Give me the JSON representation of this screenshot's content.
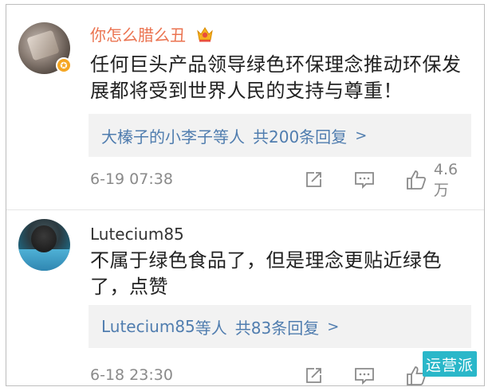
{
  "comments": [
    {
      "username": "你怎么腊么丑",
      "text": "任何巨头产品领导绿色环保理念推动环保发展都将受到世界人民的支持与尊重！",
      "replies_users": "大榛子的小李子",
      "replies_suffix": "等人",
      "replies_count": "共200条回复",
      "timestamp": "6-19 07:38",
      "likes": "4.6万",
      "verified_badge": "v-badge-icon",
      "name_color": "#eb7350"
    },
    {
      "username": "Lutecium85",
      "text": "不属于绿色食品了，但是理念更贴近绿色了，点赞",
      "replies_users": "Lutecium85",
      "replies_suffix": "等人",
      "replies_count": "共83条回复",
      "timestamp": "6-18 23:30",
      "likes": "",
      "name_color": "#333333"
    }
  ],
  "colors": {
    "link": "#507daf",
    "meta": "#8a8a8a",
    "reply_bg": "#f2f2f2",
    "watermark_bg": "#2ab7c9"
  },
  "watermark": "运营派"
}
